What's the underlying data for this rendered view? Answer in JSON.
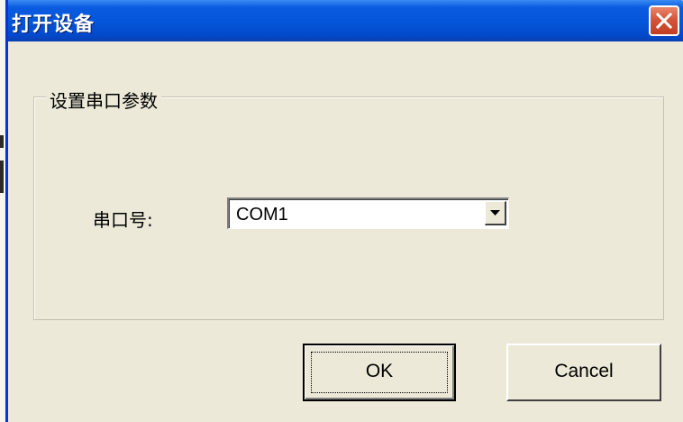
{
  "window": {
    "title": "打开设备",
    "close_icon": "close-icon"
  },
  "group": {
    "label": "设置串口参数"
  },
  "serial_port": {
    "label": "串口号:",
    "selected_value": "COM1"
  },
  "buttons": {
    "ok_label": "OK",
    "cancel_label": "Cancel"
  },
  "colors": {
    "titlebar": "#0455d8",
    "close_button": "#d4553a",
    "dialog_background": "#ece9d8"
  }
}
